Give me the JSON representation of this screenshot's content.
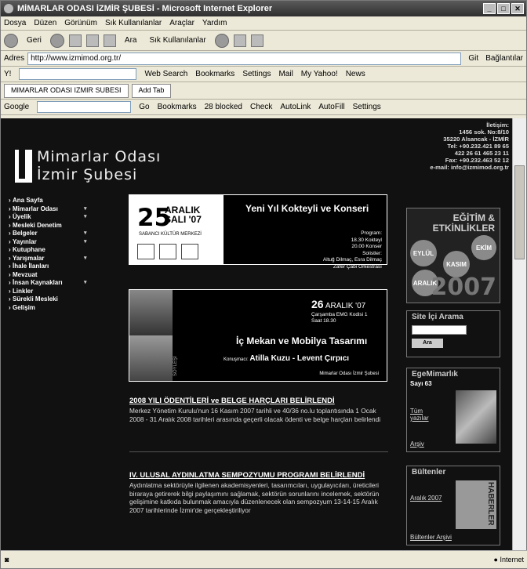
{
  "window": {
    "title": "MİMARLAR ODASI İZMİR ŞUBESİ - Microsoft Internet Explorer"
  },
  "menu": [
    "Dosya",
    "Düzen",
    "Görünüm",
    "Sık Kullanılanlar",
    "Araçlar",
    "Yardım"
  ],
  "toolbar": {
    "back": "Geri",
    "search": "Ara",
    "favorites": "Sık Kullanılanlar"
  },
  "address": {
    "label": "Adres",
    "url": "http://www.izmimod.org.tr/",
    "go": "Git",
    "links": "Bağlantılar"
  },
  "yahoo": {
    "websearch": "Web Search",
    "bookmarks": "Bookmarks",
    "settings": "Settings",
    "mail": "Mail",
    "myyahoo": "My Yahoo!",
    "news": "News"
  },
  "tabs": {
    "active": "MIMARLAR ODASI IZMIR SUBESI",
    "add": "Add Tab"
  },
  "google": {
    "label": "Google",
    "go": "Go",
    "bookmarks": "Bookmarks",
    "blocked": "28 blocked",
    "check": "Check",
    "autolink": "AutoLink",
    "autofill": "AutoFill",
    "settings": "Settings"
  },
  "site": {
    "logo_line1": "Mimarlar Odası",
    "logo_line2": "İzmir Şubesi",
    "contact": [
      "İletişim:",
      "1456 sok. No:8/10",
      "35220 Alsancak - İZMİR",
      "Tel: +90.232.421 89 65",
      "422 26 61 465 23 11",
      "Fax: +90.232.463 52 12",
      "e-mail: info@izmimod.org.tr"
    ],
    "nav": [
      {
        "l": "Ana Sayfa",
        "a": false
      },
      {
        "l": "Mimarlar Odası",
        "a": true
      },
      {
        "l": "Üyelik",
        "a": true
      },
      {
        "l": "Mesleki Denetim",
        "a": false
      },
      {
        "l": "Belgeler",
        "a": true
      },
      {
        "l": "Yayınlar",
        "a": true
      },
      {
        "l": "Kutuphane",
        "a": false
      },
      {
        "l": "Yarışmalar",
        "a": true
      },
      {
        "l": "İhale İlanları",
        "a": false
      },
      {
        "l": "Mevzuat",
        "a": false
      },
      {
        "l": "İnsan Kaynakları",
        "a": true
      },
      {
        "l": "Linkler",
        "a": false
      },
      {
        "l": "Sürekli Mesleki",
        "a": false
      },
      {
        "l": "Gelişim",
        "a": false
      }
    ],
    "banner1": {
      "day": "25",
      "month": "ARALIK",
      "weekday_year": "SALI '07",
      "venue": "SABANCI KÜLTÜR MERKEZİ",
      "title": "Yeni Yıl Kokteyli ve Konseri",
      "info": [
        "Program:",
        "18.30 Kokteyl",
        "20.00 Konser",
        "Solistler:",
        "Altuğ Dilmaç, Esra Dilmaç",
        "Zafer Çabi Orkestrası"
      ]
    },
    "banner2": {
      "day": "26",
      "month_year": "ARALIK '07",
      "place": [
        "Çarşamba  EMG Kodisi 1",
        "Saat 18.30"
      ],
      "label": "SÖYLEŞİ",
      "title": "İç Mekan ve Mobilya Tasarımı",
      "speakers_label": "Konuşmacı:",
      "speakers": "Atilla Kuzu - Levent Çırpıcı",
      "org": "Mimarlar Odası İzmir Şubesi"
    },
    "articles": [
      {
        "title": "2008 YILI ÖDENTİLERİ ve BELGE HARÇLARI BELİRLENDİ",
        "text": "Merkez Yönetim Kurulu'nun 16 Kasım 2007 tarihli ve 40/36 no.lu toplantısında 1 Ocak 2008 - 31 Aralık 2008 tarihleri arasında geçerli olacak ödenti ve belge harçları belirlendi"
      },
      {
        "title": "IV. ULUSAL AYDINLATMA SEMPOZYUMU PROGRAMI BELİRLENDİ",
        "text": "Aydınlatma sektörüyle ilgilenen akademisyenleri, tasarımcıları, uygulayıcıları, üreticileri biraraya getirerek bilgi paylaşımını sağlamak, sektörün sorunlarını incelemek, sektörün gelişimine katkıda bulunmak amacıyla düzenlenecek olan sempozyum 13-14-15 Aralık 2007 tarihlerinde İzmir'de gerçekleştiriliyor"
      }
    ],
    "egitim": {
      "title1": "EĞİTİM &",
      "title2": "ETKİNLİKLER",
      "months": [
        "EYLÜL",
        "KASIM",
        "EKİM",
        "ARALIK"
      ],
      "year": "2007"
    },
    "search": {
      "title": "Site İçi Arama",
      "button": "Ara"
    },
    "ege": {
      "title": "EgeMimarlık",
      "issue": "Sayı 63",
      "all": "Tüm",
      "all2": "yazılar",
      "archive": "Arşiv"
    },
    "bulten": {
      "title": "Bültenler",
      "issue": "Aralık 2007",
      "cover": "HABERLER",
      "archive": "Bültenler Arşivi"
    }
  },
  "status": {
    "zone": "Internet"
  }
}
